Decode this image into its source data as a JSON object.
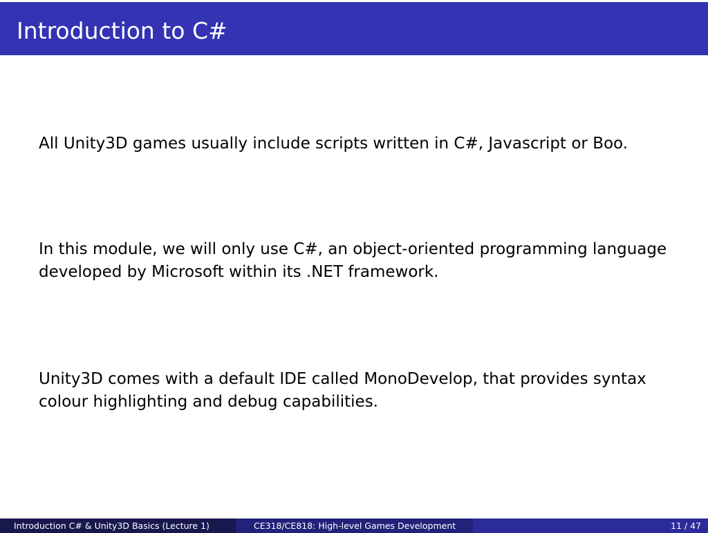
{
  "slide": {
    "title": "Introduction to C#"
  },
  "body": {
    "paragraph_1": "All Unity3D games usually include scripts written in C#, Javascript or Boo.",
    "paragraph_2": "In this module, we will only use C#, an object-oriented programming language developed by Microsoft within its .NET framework.",
    "paragraph_3": "Unity3D comes with a default IDE called MonoDevelop, that provides syntax colour highlighting and debug capabilities."
  },
  "footer": {
    "lecture": "Introduction C# & Unity3D Basics  (Lecture 1)",
    "course": "CE318/CE818: High-level Games Development",
    "page": "11 / 47"
  },
  "colors": {
    "title_bar": "#3333b3",
    "footer_left": "#18184f",
    "footer_mid": "#22227a",
    "footer_right": "#2b2b99"
  }
}
